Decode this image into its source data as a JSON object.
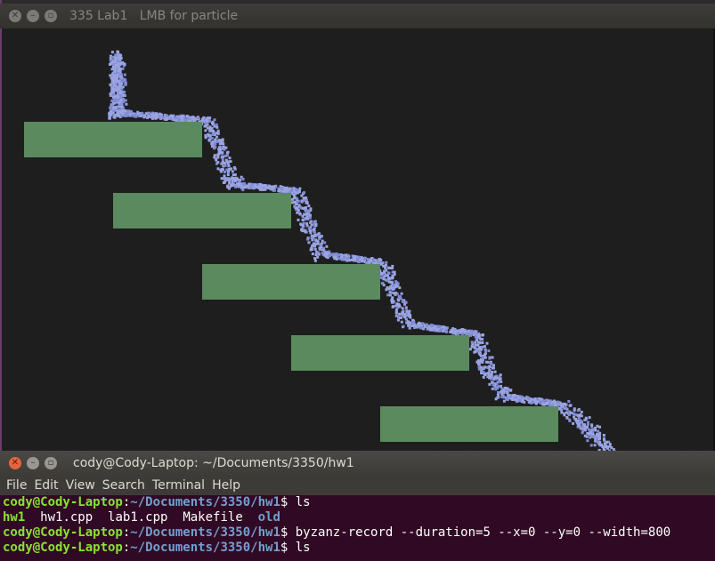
{
  "lab_window": {
    "title": "335 Lab1   LMB for particle",
    "colors": {
      "background": "#1e1e1e",
      "platform": "#5a8a5e",
      "particle": "#9aa4e2",
      "particle_dark": "#7f8bd4"
    }
  },
  "terminal": {
    "title": "cody@Cody-Laptop: ~/Documents/3350/hw1",
    "menu": [
      "File",
      "Edit",
      "View",
      "Search",
      "Terminal",
      "Help"
    ],
    "prompt_user": "cody@Cody-Laptop",
    "prompt_sep": ":",
    "prompt_path": "~/Documents/3350/hw1",
    "prompt_end": "$ ",
    "cmd1": "ls",
    "files": [
      {
        "name": "hw1",
        "kind": "exe"
      },
      {
        "name": "hw1.cpp",
        "kind": "plain"
      },
      {
        "name": "lab1.cpp",
        "kind": "plain"
      },
      {
        "name": "Makefile",
        "kind": "plain"
      },
      {
        "name": "old",
        "kind": "dir"
      }
    ],
    "cmd2": "byzanz-record --duration=5 --x=0 --y=0 --width=800",
    "cmd3": "ls"
  }
}
